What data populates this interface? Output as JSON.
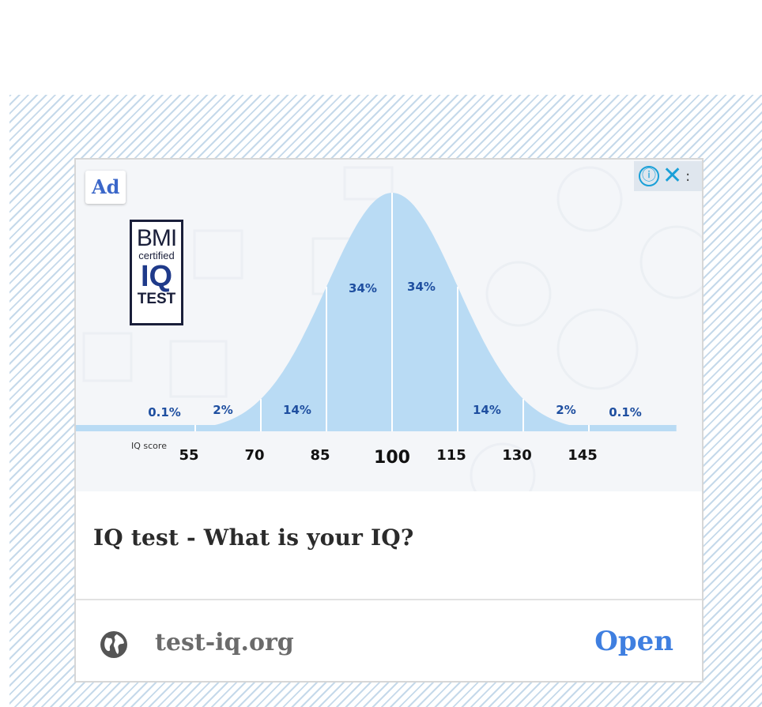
{
  "ad": {
    "badge": "Ad",
    "info_icon": "ⓘ",
    "close_icon": "✕",
    "more_icon": ":",
    "title": "IQ test - What is your IQ?",
    "domain": "test-iq.org",
    "open_label": "Open"
  },
  "logo": {
    "line1": "BMI",
    "line2": "certified",
    "line3": "IQ",
    "line4": "TEST"
  },
  "chart_data": {
    "type": "area",
    "xlabel": "IQ score",
    "x_ticks": [
      "55",
      "70",
      "85",
      "100",
      "115",
      "130",
      "145"
    ],
    "segments": [
      {
        "range": "<55",
        "percent": "0.1%"
      },
      {
        "range": "55-70",
        "percent": "2%"
      },
      {
        "range": "70-85",
        "percent": "14%"
      },
      {
        "range": "85-100",
        "percent": "34%"
      },
      {
        "range": "100-115",
        "percent": "34%"
      },
      {
        "range": "115-130",
        "percent": "14%"
      },
      {
        "range": "130-145",
        "percent": "2%"
      },
      {
        "range": ">145",
        "percent": "0.1%"
      }
    ],
    "mean": 100,
    "sd": 15,
    "fill_color": "#b9dbf4",
    "label_color": "#1f4fa0"
  },
  "colors": {
    "accent": "#3b67c9",
    "open": "#3f7fe0",
    "hatch": "#c5d9ea"
  }
}
